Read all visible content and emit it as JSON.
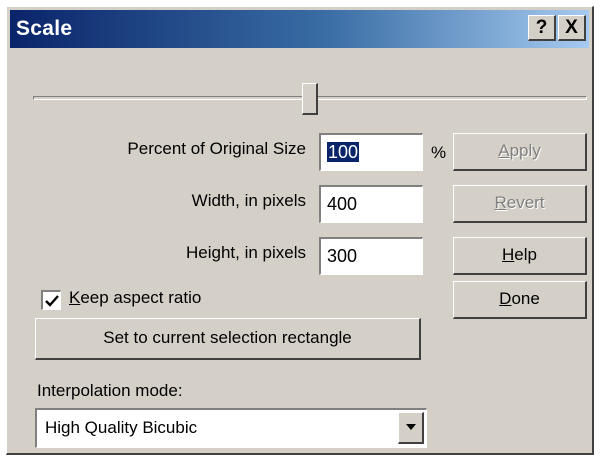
{
  "window": {
    "title": "Scale",
    "help_glyph": "?",
    "close_glyph": "X"
  },
  "slider": {
    "value_percent": 100,
    "position_fraction": 0.5
  },
  "fields": {
    "percent": {
      "label": "Percent of Original Size",
      "value": "100",
      "unit": "%"
    },
    "width": {
      "label": "Width, in pixels",
      "value": "400"
    },
    "height": {
      "label": "Height, in pixels",
      "value": "300"
    }
  },
  "buttons": {
    "apply": {
      "first": "A",
      "rest": "pply",
      "enabled": false
    },
    "revert": {
      "first": "R",
      "rest": "evert",
      "enabled": false
    },
    "help": {
      "first": "H",
      "rest": "elp",
      "enabled": true
    },
    "done": {
      "first": "D",
      "rest": "one",
      "enabled": true
    }
  },
  "keep_aspect": {
    "first": "K",
    "rest": "eep aspect ratio",
    "checked": true
  },
  "set_selection_label": "Set to current selection rectangle",
  "interpolation": {
    "label": "Interpolation mode:",
    "selected": "High Quality Bicubic"
  },
  "icons": {
    "check": "check-icon",
    "dropdown": "chevron-down-icon"
  }
}
